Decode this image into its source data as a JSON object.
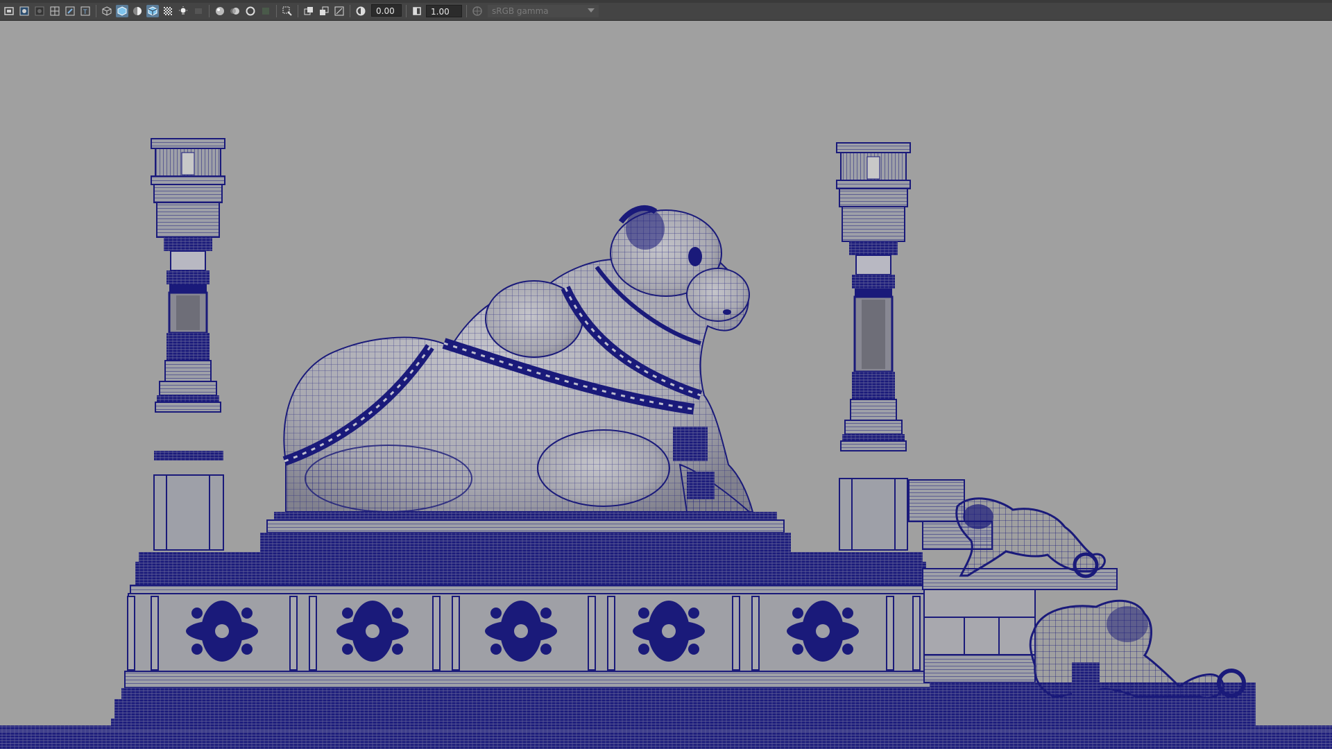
{
  "toolbar": {
    "exposure_value": "0.00",
    "gamma_value": "1.00",
    "color_space_label": "sRGB gamma",
    "icons": [
      "camera-attributes-icon",
      "bookmark-icon",
      "image-plane-icon",
      "grid-icon",
      "film-gate-icon",
      "resolution-gate-icon",
      "gate-mask-icon",
      "field-chart-icon",
      "safe-action-icon",
      "safe-title-icon",
      "wireframe-icon",
      "smooth-shade-icon",
      "bounding-box-icon",
      "use-default-material-icon",
      "wireframe-on-shaded-icon",
      "xray-icon",
      "xray-joints-icon",
      "lights-icon",
      "shadows-icon",
      "screen-space-ao-icon",
      "motion-blur-icon",
      "multisample-aa-icon",
      "depth-of-field-icon",
      "isolate-select-icon",
      "xray-active-components-icon",
      "hud-icon",
      "exposure-icon",
      "gamma-icon",
      "color-management-icon"
    ]
  },
  "colors": {
    "viewport_bg": "#a0a0a0",
    "wire": "#1a1a7a",
    "wire_dense": "#10106a",
    "toolbar_bg": "#444444",
    "active_icon": "#5a7c99"
  },
  "viewport": {
    "scene": "wireframe-on-shaded"
  }
}
